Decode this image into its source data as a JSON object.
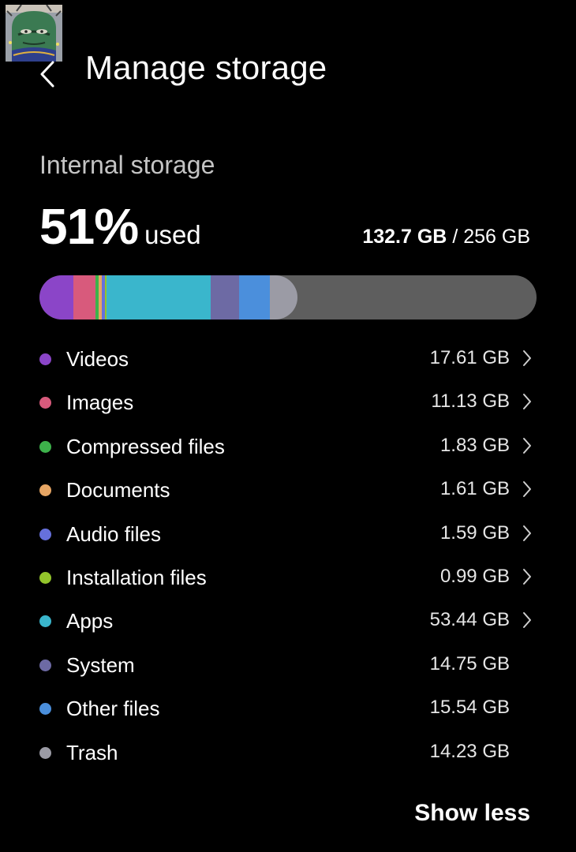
{
  "header": {
    "title": "Manage storage"
  },
  "storage": {
    "section_title": "Internal storage",
    "percent_used": "51%",
    "percent_suffix": "used",
    "used": "132.7 GB",
    "separator": "/",
    "total": "256 GB",
    "used_fraction": 0.51
  },
  "categories": [
    {
      "name": "Videos",
      "size": "17.61 GB",
      "color": "#8b45c8",
      "chevron": true
    },
    {
      "name": "Images",
      "size": "11.13 GB",
      "color": "#d85a7c",
      "chevron": true
    },
    {
      "name": "Compressed files",
      "size": "1.83 GB",
      "color": "#3db24b",
      "chevron": true
    },
    {
      "name": "Documents",
      "size": "1.61 GB",
      "color": "#e7a664",
      "chevron": true
    },
    {
      "name": "Audio files",
      "size": "1.59 GB",
      "color": "#6670dc",
      "chevron": true
    },
    {
      "name": "Installation files",
      "size": "0.99 GB",
      "color": "#93c52b",
      "chevron": true
    },
    {
      "name": "Apps",
      "size": "53.44 GB",
      "color": "#3ab6cc",
      "chevron": true
    },
    {
      "name": "System",
      "size": "14.75 GB",
      "color": "#6d6aa4",
      "chevron": false
    },
    {
      "name": "Other files",
      "size": "15.54 GB",
      "color": "#4b8fdc",
      "chevron": false
    },
    {
      "name": "Trash",
      "size": "14.23 GB",
      "color": "#9b9ba5",
      "chevron": false
    }
  ],
  "actions": {
    "show_less": "Show less"
  },
  "icons": {
    "back": "back-arrow-icon",
    "chevron": "chevron-right-icon",
    "avatar": "avatar-image"
  },
  "colors": {
    "background": "#000000",
    "bar_track": "#5e5e5e"
  }
}
